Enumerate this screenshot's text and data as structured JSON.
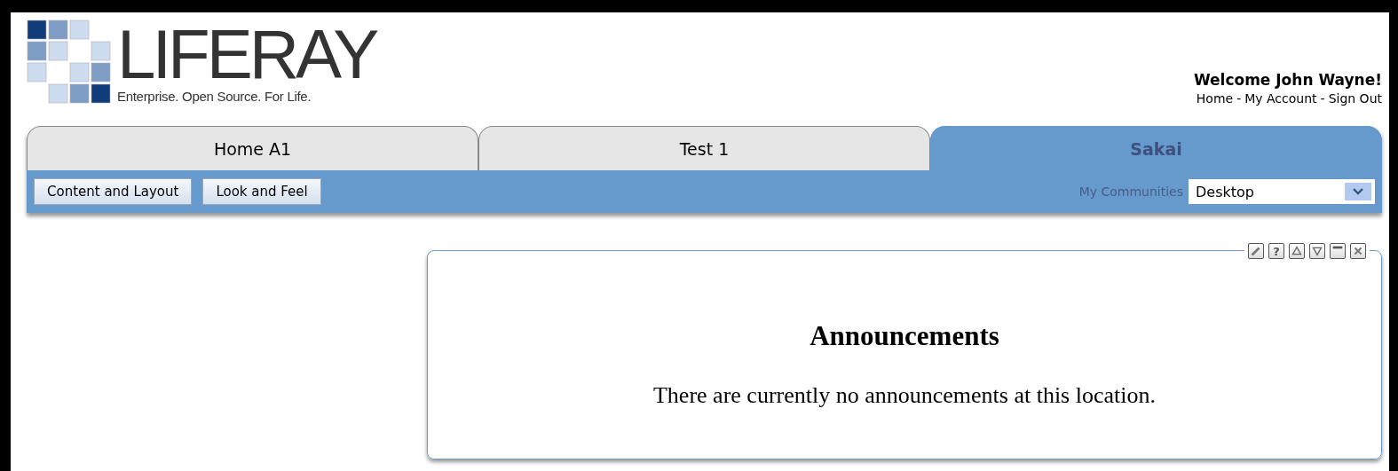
{
  "logo": {
    "name": "LIFERAY",
    "tagline": "Enterprise. Open Source. For Life."
  },
  "user": {
    "welcome": "Welcome John Wayne!",
    "links": [
      {
        "label": "Home"
      },
      {
        "label": "My Account"
      },
      {
        "label": "Sign Out"
      }
    ],
    "separator": "-"
  },
  "tabs": [
    {
      "label": "Home A1",
      "selected": false
    },
    {
      "label": "Test 1",
      "selected": false
    },
    {
      "label": "Sakai",
      "selected": true
    }
  ],
  "toolbar": {
    "buttons": [
      "Content and Layout",
      "Look and Feel"
    ],
    "communities_label": "My Communities",
    "communities_value": "Desktop"
  },
  "portlet": {
    "icons": [
      {
        "kind": "edit"
      },
      {
        "kind": "help",
        "label": "?"
      },
      {
        "kind": "up"
      },
      {
        "kind": "down"
      },
      {
        "kind": "minimize"
      },
      {
        "kind": "close"
      }
    ],
    "title": "Announcements",
    "message": "There are currently no announcements at this location."
  }
}
